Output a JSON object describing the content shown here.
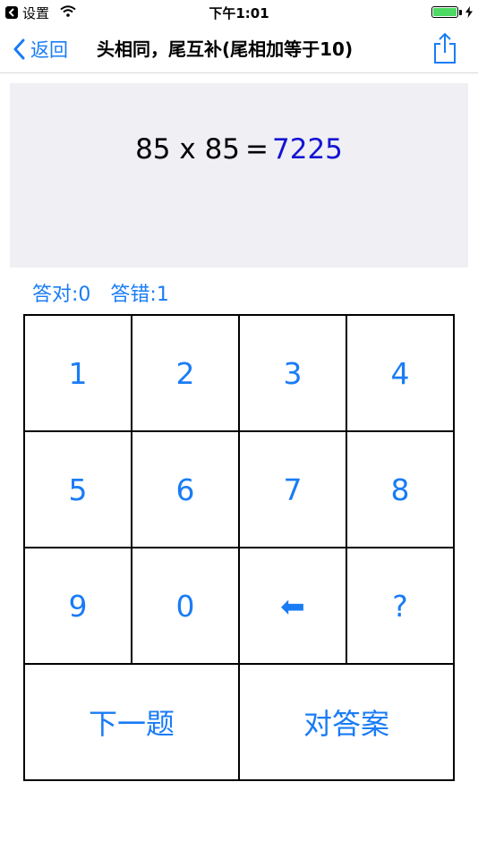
{
  "status_bar": {
    "app_name": "设置",
    "time": "下午1:01",
    "battery_color": "#4cd964"
  },
  "nav": {
    "back_label": "返回",
    "title": "头相同，尾互补(尾相加等于10)",
    "accent_color": "#1a7cf5"
  },
  "question": {
    "expression": "85 x 85",
    "equals": "=",
    "answer": "7225",
    "answer_color": "#1414d2"
  },
  "score": {
    "correct": "答对:0",
    "wrong": "答错:1"
  },
  "keypad": {
    "keys": [
      "1",
      "2",
      "3",
      "4",
      "5",
      "6",
      "7",
      "8",
      "9",
      "0",
      "⬅",
      "?"
    ],
    "next_label": "下一题",
    "check_label": "对答案"
  }
}
